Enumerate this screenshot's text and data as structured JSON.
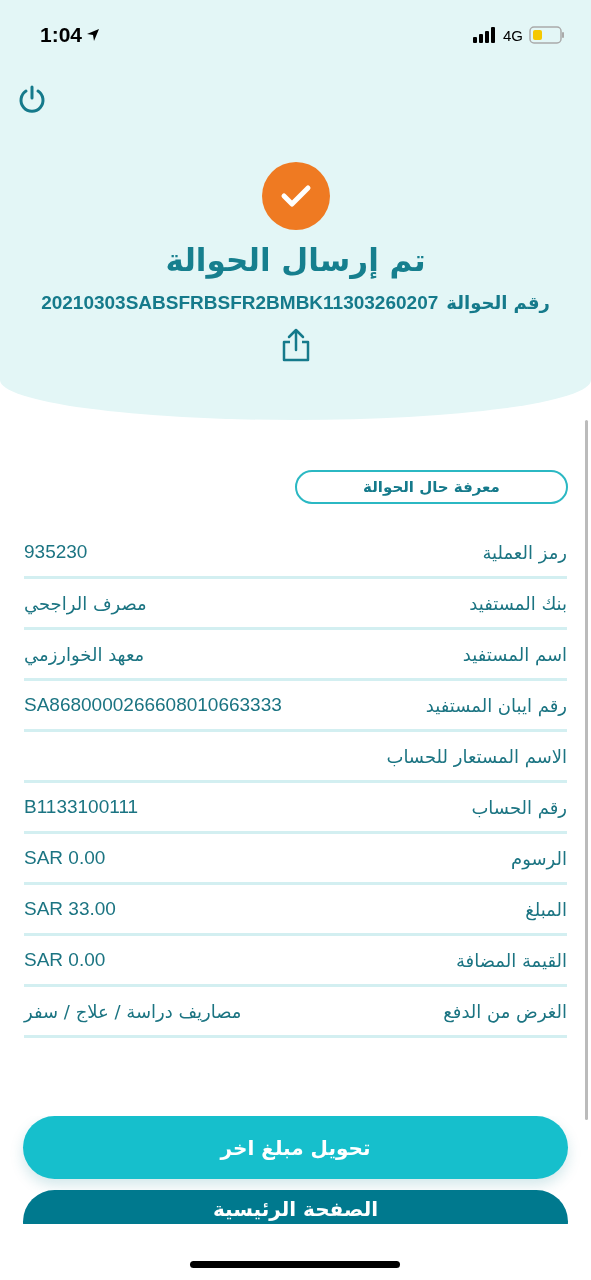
{
  "status_bar": {
    "time": "1:04",
    "network": "4G"
  },
  "header": {
    "title": "تم إرسال الحوالة",
    "reference_label": "رقم الحوالة",
    "reference_number": "20210303SABSFRBSFR2BMBK11303260207"
  },
  "status_button": "معرفة حال الحوالة",
  "details": [
    {
      "label": "رمز العملية",
      "value": "935230"
    },
    {
      "label": "بنك المستفيد",
      "value": "مصرف الراجحي"
    },
    {
      "label": "اسم المستفيد",
      "value": "معهد الخوارزمي"
    },
    {
      "label": "رقم ايبان المستفيد",
      "value": "SA8680000266608010663333"
    },
    {
      "label": "الاسم المستعار للحساب"
    },
    {
      "label": "رقم الحساب",
      "value": "B1133100111"
    },
    {
      "label": "الرسوم",
      "value": "SAR 0.00"
    },
    {
      "label": "المبلغ",
      "value": "SAR 33.00"
    },
    {
      "label": "القيمة المضافة",
      "value": "SAR 0.00"
    },
    {
      "label": "الغرض من الدفع",
      "value": "مصاريف دراسة / علاج / سفر"
    }
  ],
  "buttons": [
    {
      "label": "تحويل مبلغ اخر",
      "kind": "primary"
    },
    {
      "label": "الصفحة الرئيسية",
      "kind": "secondary"
    }
  ]
}
